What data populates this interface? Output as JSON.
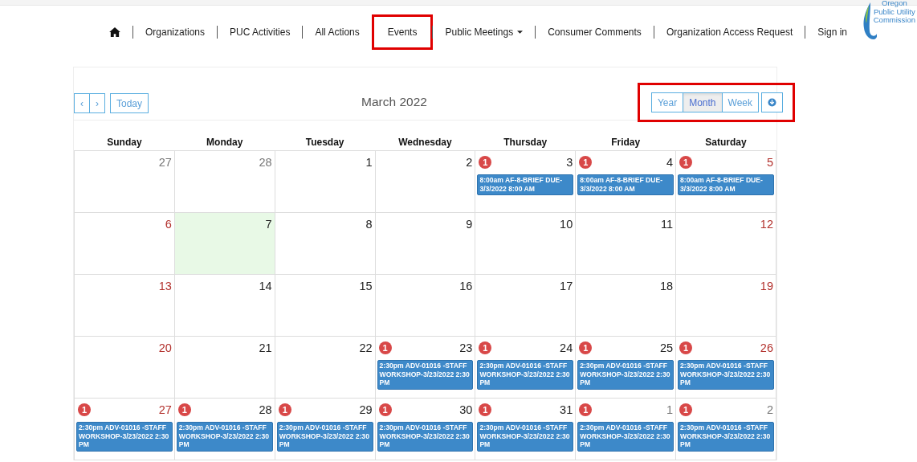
{
  "nav": {
    "items": [
      {
        "kind": "home",
        "highlighted": false
      },
      {
        "kind": "link",
        "label": "Organizations",
        "highlighted": false
      },
      {
        "kind": "link",
        "label": "PUC Activities",
        "highlighted": false
      },
      {
        "kind": "link",
        "label": "All Actions",
        "highlighted": false
      },
      {
        "kind": "link",
        "label": "Events",
        "highlighted": true
      },
      {
        "kind": "dropdown",
        "label": "Public Meetings",
        "highlighted": false
      },
      {
        "kind": "link",
        "label": "Consumer Comments",
        "highlighted": false
      },
      {
        "kind": "link",
        "label": "Organization Access Request",
        "highlighted": false
      },
      {
        "kind": "link",
        "label": "Sign in",
        "highlighted": false
      }
    ],
    "logo": [
      "Oregon",
      "Public Utility",
      "Commission"
    ]
  },
  "calendar": {
    "prev": "‹",
    "next": "›",
    "today": "Today",
    "title": "March 2022",
    "views": [
      {
        "label": "Year",
        "selected": false
      },
      {
        "label": "Month",
        "selected": true
      },
      {
        "label": "Week",
        "selected": false
      }
    ],
    "views_highlighted": true,
    "weekdays": [
      "Sunday",
      "Monday",
      "Tuesday",
      "Wednesday",
      "Thursday",
      "Friday",
      "Saturday"
    ],
    "weeks": [
      [
        {
          "day": "27",
          "kind": "other"
        },
        {
          "day": "28",
          "kind": "other"
        },
        {
          "day": "1",
          "kind": "weekday"
        },
        {
          "day": "2",
          "kind": "weekday"
        },
        {
          "day": "3",
          "kind": "weekday",
          "count": "1",
          "events": [
            "8:00am AF-8-BRIEF DUE-3/3/2022 8:00 AM"
          ]
        },
        {
          "day": "4",
          "kind": "weekday",
          "count": "1",
          "events": [
            "8:00am AF-8-BRIEF DUE-3/3/2022 8:00 AM"
          ]
        },
        {
          "day": "5",
          "kind": "weekend",
          "count": "1",
          "events": [
            "8:00am AF-8-BRIEF DUE-3/3/2022 8:00 AM"
          ]
        }
      ],
      [
        {
          "day": "6",
          "kind": "weekend"
        },
        {
          "day": "7",
          "kind": "weekday",
          "today": true
        },
        {
          "day": "8",
          "kind": "weekday"
        },
        {
          "day": "9",
          "kind": "weekday"
        },
        {
          "day": "10",
          "kind": "weekday"
        },
        {
          "day": "11",
          "kind": "weekday"
        },
        {
          "day": "12",
          "kind": "weekend"
        }
      ],
      [
        {
          "day": "13",
          "kind": "weekend"
        },
        {
          "day": "14",
          "kind": "weekday"
        },
        {
          "day": "15",
          "kind": "weekday"
        },
        {
          "day": "16",
          "kind": "weekday"
        },
        {
          "day": "17",
          "kind": "weekday"
        },
        {
          "day": "18",
          "kind": "weekday"
        },
        {
          "day": "19",
          "kind": "weekend"
        }
      ],
      [
        {
          "day": "20",
          "kind": "weekend"
        },
        {
          "day": "21",
          "kind": "weekday"
        },
        {
          "day": "22",
          "kind": "weekday"
        },
        {
          "day": "23",
          "kind": "weekday",
          "count": "1",
          "events": [
            "2:30pm ADV-01016 -STAFF WORKSHOP-3/23/2022 2:30 PM"
          ]
        },
        {
          "day": "24",
          "kind": "weekday",
          "count": "1",
          "events": [
            "2:30pm ADV-01016 -STAFF WORKSHOP-3/23/2022 2:30 PM"
          ]
        },
        {
          "day": "25",
          "kind": "weekday",
          "count": "1",
          "events": [
            "2:30pm ADV-01016 -STAFF WORKSHOP-3/23/2022 2:30 PM"
          ]
        },
        {
          "day": "26",
          "kind": "weekend",
          "count": "1",
          "events": [
            "2:30pm ADV-01016 -STAFF WORKSHOP-3/23/2022 2:30 PM"
          ]
        }
      ],
      [
        {
          "day": "27",
          "kind": "weekend",
          "count": "1",
          "events": [
            "2:30pm ADV-01016 -STAFF WORKSHOP-3/23/2022 2:30 PM"
          ]
        },
        {
          "day": "28",
          "kind": "weekday",
          "count": "1",
          "events": [
            "2:30pm ADV-01016 -STAFF WORKSHOP-3/23/2022 2:30 PM"
          ]
        },
        {
          "day": "29",
          "kind": "weekday",
          "count": "1",
          "events": [
            "2:30pm ADV-01016 -STAFF WORKSHOP-3/23/2022 2:30 PM"
          ]
        },
        {
          "day": "30",
          "kind": "weekday",
          "count": "1",
          "events": [
            "2:30pm ADV-01016 -STAFF WORKSHOP-3/23/2022 2:30 PM"
          ]
        },
        {
          "day": "31",
          "kind": "weekday",
          "count": "1",
          "events": [
            "2:30pm ADV-01016 -STAFF WORKSHOP-3/23/2022 2:30 PM"
          ]
        },
        {
          "day": "1",
          "kind": "other",
          "count": "1",
          "events": [
            "2:30pm ADV-01016 -STAFF WORKSHOP-3/23/2022 2:30 PM"
          ]
        },
        {
          "day": "2",
          "kind": "other",
          "count": "1",
          "events": [
            "2:30pm ADV-01016 -STAFF WORKSHOP-3/23/2022 2:30 PM"
          ]
        }
      ]
    ]
  }
}
